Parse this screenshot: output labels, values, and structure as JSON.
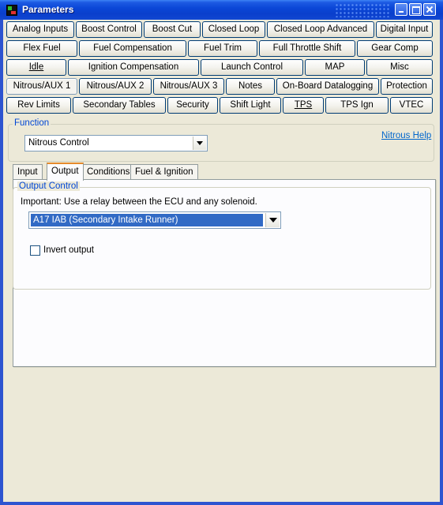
{
  "window": {
    "title": "Parameters"
  },
  "tabs_row1": [
    {
      "label": "Analog Inputs"
    },
    {
      "label": "Boost Control"
    },
    {
      "label": "Boost Cut"
    },
    {
      "label": "Closed Loop"
    },
    {
      "label": "Closed Loop Advanced"
    },
    {
      "label": "Digital Input"
    }
  ],
  "tabs_row2": [
    {
      "label": "Flex Fuel"
    },
    {
      "label": "Fuel Compensation"
    },
    {
      "label": "Fuel Trim"
    },
    {
      "label": "Full Throttle Shift"
    },
    {
      "label": "Gear Comp"
    }
  ],
  "tabs_row3": [
    {
      "label": "Idle"
    },
    {
      "label": "Ignition Compensation"
    },
    {
      "label": "Launch Control"
    },
    {
      "label": "MAP"
    },
    {
      "label": "Misc"
    }
  ],
  "tabs_row4": [
    {
      "label": "Nitrous/AUX 1"
    },
    {
      "label": "Nitrous/AUX 2"
    },
    {
      "label": "Nitrous/AUX 3"
    },
    {
      "label": "Notes"
    },
    {
      "label": "On-Board Datalogging"
    },
    {
      "label": "Protection"
    }
  ],
  "tabs_row5": [
    {
      "label": "Rev Limits"
    },
    {
      "label": "Secondary Tables"
    },
    {
      "label": "Security"
    },
    {
      "label": "Shift Light"
    },
    {
      "label": "TPS"
    },
    {
      "label": "TPS Ign"
    },
    {
      "label": "VTEC"
    }
  ],
  "function": {
    "legend": "Function",
    "selected": "Nitrous Control",
    "help_link": "Nitrous Help"
  },
  "inner_tabs": [
    {
      "label": "Input"
    },
    {
      "label": "Output"
    },
    {
      "label": "Conditions"
    },
    {
      "label": "Fuel & Ignition"
    }
  ],
  "output_control": {
    "legend": "Output Control",
    "note": "Important: Use a relay between the ECU and any solenoid.",
    "selected_output": "A17 IAB (Secondary Intake Runner)",
    "invert_label": "Invert output",
    "invert_checked": false
  }
}
